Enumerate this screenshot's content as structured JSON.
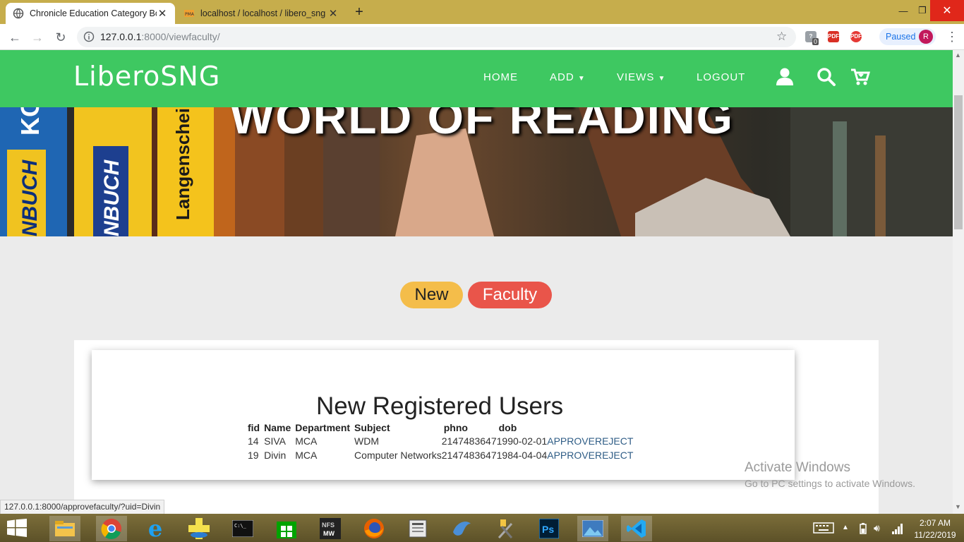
{
  "browser": {
    "tabs": [
      {
        "title": "Chronicle Education Category Bo",
        "active": true
      },
      {
        "title": "localhost / localhost / libero_sng",
        "active": false
      }
    ],
    "url_host": "127.0.0.1",
    "url_rest": ":8000/viewfaculty/",
    "profile_status": "Paused",
    "profile_initial": "R",
    "extension_badge": "0"
  },
  "site": {
    "logo": "LiberoSNG",
    "nav": {
      "home": "HOME",
      "add": "ADD",
      "views": "VIEWS",
      "logout": "LOGOUT"
    },
    "banner_title": "WORLD OF READING",
    "heading_part1": "New",
    "heading_part2": "Faculty",
    "colors": {
      "nav_green": "#3ec861",
      "pill_yellow": "#f4bd4a",
      "pill_red": "#e9554a",
      "link": "#2f5d86"
    }
  },
  "users_table": {
    "title": "New Registered Users",
    "columns": [
      "fid",
      "Name",
      "Department",
      "Subject",
      "phno",
      "dob"
    ],
    "rows": [
      {
        "fid": "14",
        "name": "SIVA",
        "department": "MCA",
        "subject": "WDM",
        "phno": "2147483647",
        "dob": "1990-02-01",
        "approve": "APPROVE",
        "reject": "REJECT"
      },
      {
        "fid": "19",
        "name": "Divin",
        "department": "MCA",
        "subject": "Computer Networks",
        "phno": "2147483647",
        "dob": "1984-04-04",
        "approve": "APPROVE",
        "reject": "REJECT"
      }
    ]
  },
  "watermark": {
    "line1": "Activate Windows",
    "line2": "Go to PC settings to activate Windows."
  },
  "status_url": "127.0.0.1:8000/approvefaculty/?uid=Divin",
  "taskbar": {
    "time": "2:07 AM",
    "date": "11/22/2019"
  }
}
